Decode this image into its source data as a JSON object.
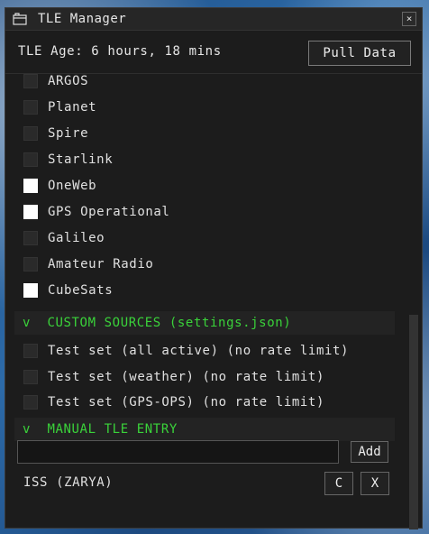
{
  "window": {
    "title": "TLE Manager",
    "close_label": "×"
  },
  "header": {
    "age_text": "TLE Age: 6 hours, 18 mins",
    "pull_label": "Pull Data"
  },
  "sources": [
    {
      "label": "ARGOS",
      "checked": false
    },
    {
      "label": "Planet",
      "checked": false
    },
    {
      "label": "Spire",
      "checked": false
    },
    {
      "label": "Starlink",
      "checked": false
    },
    {
      "label": "OneWeb",
      "checked": true
    },
    {
      "label": "GPS Operational",
      "checked": true
    },
    {
      "label": "Galileo",
      "checked": false
    },
    {
      "label": "Amateur Radio",
      "checked": false
    },
    {
      "label": "CubeSats",
      "checked": true
    }
  ],
  "custom": {
    "chevron": "v",
    "title": "CUSTOM SOURCES (settings.json)",
    "items": [
      {
        "label": "Test set (all active) (no rate limit)",
        "checked": false
      },
      {
        "label": "Test set (weather) (no rate limit)",
        "checked": false
      },
      {
        "label": "Test set (GPS-OPS) (no rate limit)",
        "checked": false
      }
    ]
  },
  "manual": {
    "chevron": "v",
    "title": "MANUAL TLE ENTRY",
    "input_value": "",
    "add_label": "Add",
    "entries": [
      {
        "name": "ISS (ZARYA)",
        "c_label": "C",
        "x_label": "X"
      }
    ]
  },
  "colors": {
    "accent_green": "#3ad33a",
    "panel_bg": "#1c1c1c"
  }
}
